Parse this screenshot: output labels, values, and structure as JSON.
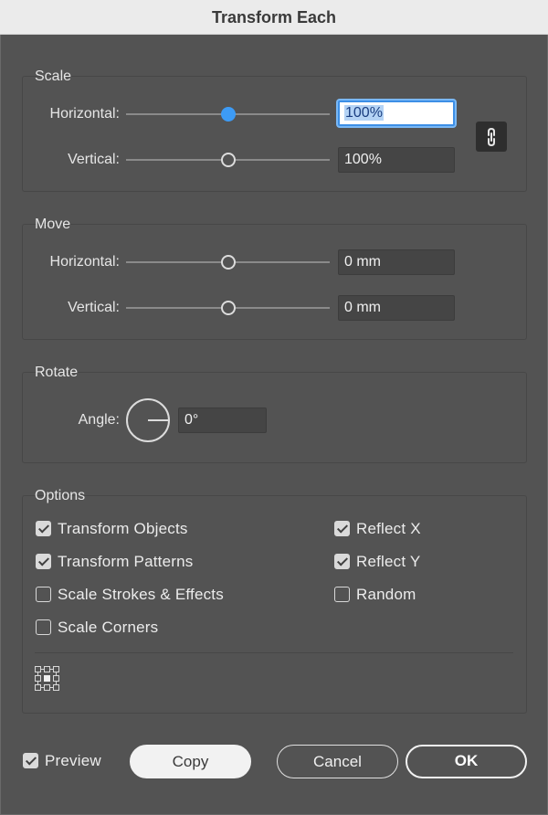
{
  "window": {
    "title": "Transform Each"
  },
  "scale": {
    "title": "Scale",
    "horizontal": {
      "label": "Horizontal:",
      "value": "100%",
      "level": 0.5
    },
    "vertical": {
      "label": "Vertical:",
      "value": "100%",
      "level": 0.5
    },
    "link_icon": "chain-link-icon"
  },
  "move": {
    "title": "Move",
    "horizontal": {
      "label": "Horizontal:",
      "value": "0 mm",
      "level": 0.5
    },
    "vertical": {
      "label": "Vertical:",
      "value": "0 mm",
      "level": 0.5
    }
  },
  "rotate": {
    "title": "Rotate",
    "angle": {
      "label": "Angle:",
      "value": "0°"
    },
    "dial_icon": "angle-dial-icon"
  },
  "options": {
    "title": "Options",
    "transform_objects": {
      "label": "Transform Objects",
      "checked": true
    },
    "transform_patterns": {
      "label": "Transform Patterns",
      "checked": true
    },
    "scale_strokes": {
      "label": "Scale Strokes & Effects",
      "checked": false
    },
    "scale_corners": {
      "label": "Scale Corners",
      "checked": false
    },
    "reflect_x": {
      "label": "Reflect X",
      "checked": true
    },
    "reflect_y": {
      "label": "Reflect Y",
      "checked": true
    },
    "random": {
      "label": "Random",
      "checked": false
    },
    "reference_point_icon": "reference-point-locator-icon"
  },
  "footer": {
    "preview": {
      "label": "Preview",
      "checked": true
    },
    "copy_label": "Copy",
    "cancel_label": "Cancel",
    "ok_label": "OK"
  },
  "colors": {
    "dialog_bg": "#535353",
    "accent": "#3d9bf5",
    "titlebar_bg": "#ebebeb"
  }
}
